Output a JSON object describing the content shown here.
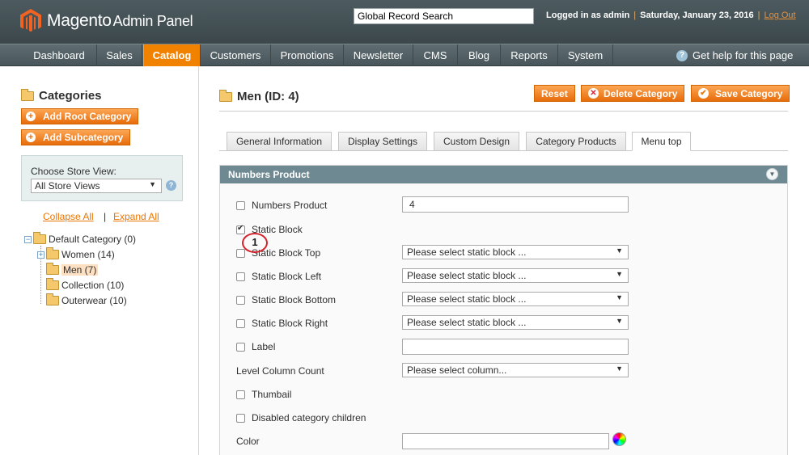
{
  "header": {
    "logo_brand": "Magento",
    "logo_suffix": "Admin Panel",
    "search_value": "Global Record Search",
    "logged_in": "Logged in as admin",
    "date": "Saturday, January 23, 2016",
    "logout": "Log Out"
  },
  "nav": {
    "items": [
      "Dashboard",
      "Sales",
      "Catalog",
      "Customers",
      "Promotions",
      "Newsletter",
      "CMS",
      "Blog",
      "Reports",
      "System"
    ],
    "active": "Catalog",
    "help": "Get help for this page"
  },
  "sidebar": {
    "title": "Categories",
    "add_root": "Add Root Category",
    "add_sub": "Add Subcategory",
    "store_label": "Choose Store View:",
    "store_value": "All Store Views",
    "collapse_all": "Collapse All",
    "expand_all": "Expand All",
    "separator": "|",
    "tree": [
      {
        "label": "Default Category (0)"
      },
      {
        "label": "Women (14)"
      },
      {
        "label": "Men (7)",
        "selected": true
      },
      {
        "label": "Collection (10)"
      },
      {
        "label": "Outerwear (10)"
      }
    ]
  },
  "main": {
    "title": "Men (ID: 4)",
    "buttons": {
      "reset": "Reset",
      "delete": "Delete Category",
      "save": "Save Category"
    },
    "tabs": [
      "General Information",
      "Display Settings",
      "Custom Design",
      "Category Products",
      "Menu top"
    ],
    "active_tab": "Menu top",
    "fieldset_title": "Numbers Product",
    "marker": "1",
    "fields": [
      {
        "label": "Numbers Product",
        "checkbox": true,
        "checked": false,
        "type": "input",
        "value": "4"
      },
      {
        "label": "Static Block",
        "checkbox": true,
        "checked": true,
        "type": "none"
      },
      {
        "label": "Static Block Top",
        "checkbox": true,
        "checked": false,
        "type": "select",
        "value": "Please select static block ..."
      },
      {
        "label": "Static Block Left",
        "checkbox": true,
        "checked": false,
        "type": "select",
        "value": "Please select static block ..."
      },
      {
        "label": "Static Block Bottom",
        "checkbox": true,
        "checked": false,
        "type": "select",
        "value": "Please select static block ..."
      },
      {
        "label": "Static Block Right",
        "checkbox": true,
        "checked": false,
        "type": "select",
        "value": "Please select static block ..."
      },
      {
        "label": "Label",
        "checkbox": true,
        "checked": false,
        "type": "input",
        "value": ""
      },
      {
        "label": "Level Column Count",
        "checkbox": false,
        "type": "select",
        "value": "Please select column..."
      },
      {
        "label": "Thumbail",
        "checkbox": true,
        "checked": false,
        "type": "none"
      },
      {
        "label": "Disabled category children",
        "checkbox": true,
        "checked": false,
        "type": "none"
      },
      {
        "label": "Color",
        "checkbox": false,
        "type": "input",
        "value": ""
      }
    ]
  },
  "icons": {
    "logo": "magento-logo-icon",
    "help": "help-icon",
    "folder": "folder-icon",
    "plus": "plus-circle-icon",
    "delete": "x-circle-icon",
    "save": "check-circle-icon",
    "collapse": "chevron-down-icon",
    "color": "color-wheel-icon"
  },
  "colors": {
    "accent": "#f18200",
    "header": "#3b474b",
    "fieldset_head": "#6f8992",
    "marker": "#d3232a"
  }
}
